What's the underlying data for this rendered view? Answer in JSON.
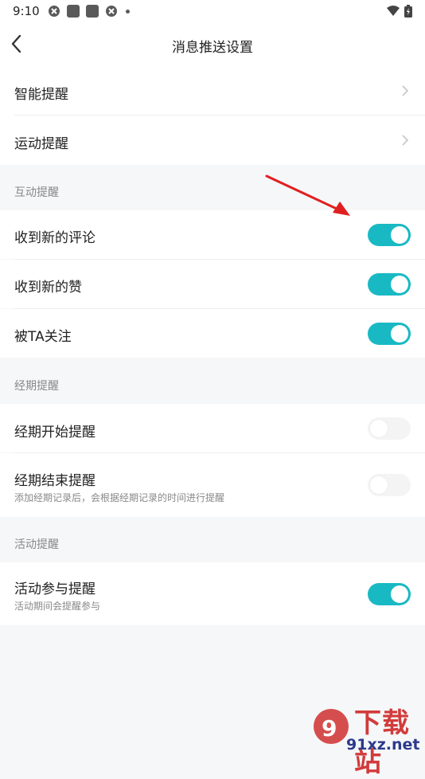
{
  "status": {
    "time": "9:10"
  },
  "header": {
    "title": "消息推送设置"
  },
  "top_items": [
    {
      "label": "智能提醒"
    },
    {
      "label": "运动提醒"
    }
  ],
  "sections": [
    {
      "title": "互动提醒",
      "items": [
        {
          "label": "收到新的评论",
          "on": true
        },
        {
          "label": "收到新的赞",
          "on": true
        },
        {
          "label": "被TA关注",
          "on": true
        }
      ]
    },
    {
      "title": "经期提醒",
      "items": [
        {
          "label": "经期开始提醒",
          "on": false
        },
        {
          "label": "经期结束提醒",
          "sub": "添加经期记录后，会根据经期记录的时间进行提醒",
          "on": false
        }
      ]
    },
    {
      "title": "活动提醒",
      "items": [
        {
          "label": "活动参与提醒",
          "sub": "活动期间会提醒参与",
          "on": true
        }
      ]
    }
  ],
  "watermark": {
    "brand": "下载站",
    "domain": "91xz.net"
  },
  "colors": {
    "accent": "#19b9c4",
    "arrow": "#e02020"
  }
}
